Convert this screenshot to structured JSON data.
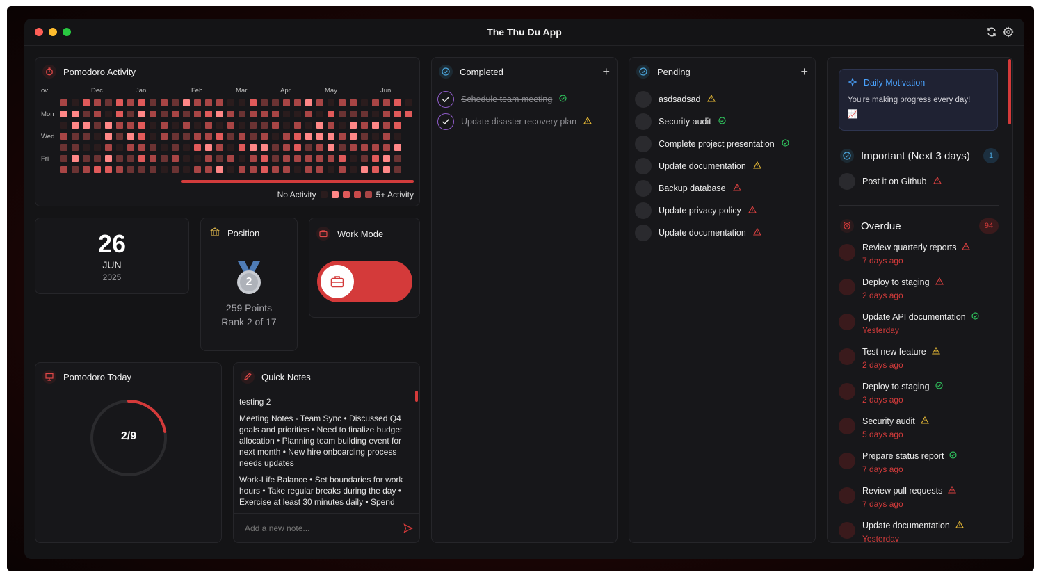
{
  "app": {
    "title": "The Thu Du App"
  },
  "heatmap": {
    "title": "Pomodoro Activity",
    "months": [
      "ov",
      "Dec",
      "Jan",
      "Feb",
      "Mar",
      "Apr",
      "May",
      "Jun"
    ],
    "days": [
      "Mon",
      "Wed",
      "Fri"
    ],
    "legend_low": "No Activity",
    "legend_high": "5+ Activity",
    "colors": {
      "l0": "#2a1c1d",
      "l1": "#6b3333",
      "l2": "#a84545",
      "l3": "#e05a5a",
      "l4": "#ff8787"
    }
  },
  "date_card": {
    "day": "26",
    "month": "JUN",
    "year": "2025"
  },
  "position": {
    "title": "Position",
    "medal_number": "2",
    "points": "259 Points",
    "rank": "Rank 2 of 17"
  },
  "work_mode": {
    "title": "Work Mode",
    "enabled": true
  },
  "pomodoro_today": {
    "title": "Pomodoro Today",
    "label": "2/9",
    "done": 2,
    "total": 9
  },
  "quick_notes": {
    "title": "Quick Notes",
    "notes": [
      "testing 2",
      "Meeting Notes - Team Sync • Discussed Q4 goals and priorities • Need to finalize budget allocation • Planning team building event for next month • New hire onboarding process needs updates",
      "Work-Life Balance • Set boundaries for work hours • Take regular breaks during the day • Exercise at least 30 minutes daily • Spend"
    ],
    "placeholder": "Add a new note..."
  },
  "completed": {
    "title": "Completed",
    "tasks": [
      {
        "label": "Schedule team meeting",
        "status": "ok"
      },
      {
        "label": "Update disaster recovery plan",
        "status": "warn"
      }
    ]
  },
  "pending": {
    "title": "Pending",
    "tasks": [
      {
        "label": "asdsadsad",
        "status": "warn"
      },
      {
        "label": "Security audit",
        "status": "ok"
      },
      {
        "label": "Complete project presentation",
        "status": "ok"
      },
      {
        "label": "Update documentation",
        "status": "warn"
      },
      {
        "label": "Backup database",
        "status": "err"
      },
      {
        "label": "Update privacy policy",
        "status": "err"
      },
      {
        "label": "Update documentation",
        "status": "err"
      }
    ]
  },
  "motivation": {
    "title": "Daily Motivation",
    "text": "You're making progress every day!",
    "emoji": "📈"
  },
  "important": {
    "title": "Important (Next 3 days)",
    "count": "1",
    "tasks": [
      {
        "label": "Post it on Github",
        "status": "err"
      }
    ]
  },
  "overdue": {
    "title": "Overdue",
    "count": "94",
    "tasks": [
      {
        "label": "Review quarterly reports",
        "date": "7 days ago",
        "status": "err"
      },
      {
        "label": "Deploy to staging",
        "date": "2 days ago",
        "status": "err"
      },
      {
        "label": "Update API documentation",
        "date": "Yesterday",
        "status": "ok"
      },
      {
        "label": "Test new feature",
        "date": "2 days ago",
        "status": "warn"
      },
      {
        "label": "Deploy to staging",
        "date": "2 days ago",
        "status": "ok"
      },
      {
        "label": "Security audit",
        "date": "5 days ago",
        "status": "warn"
      },
      {
        "label": "Prepare status report",
        "date": "7 days ago",
        "status": "ok"
      },
      {
        "label": "Review pull requests",
        "date": "7 days ago",
        "status": "err"
      },
      {
        "label": "Update documentation",
        "date": "Yesterday",
        "status": "warn"
      }
    ]
  }
}
